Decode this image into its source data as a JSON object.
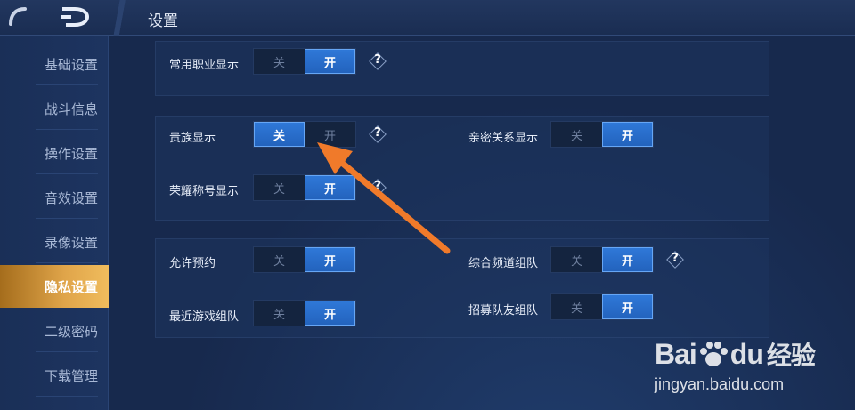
{
  "header": {
    "title": "设置"
  },
  "sidebar": {
    "items": [
      {
        "label": "基础设置"
      },
      {
        "label": "战斗信息"
      },
      {
        "label": "操作设置"
      },
      {
        "label": "音效设置"
      },
      {
        "label": "录像设置"
      },
      {
        "label": "隐私设置",
        "active": true
      },
      {
        "label": "二级密码"
      },
      {
        "label": "下载管理"
      }
    ]
  },
  "toggle_text": {
    "off": "关",
    "on": "开"
  },
  "help_text": "?",
  "settings": {
    "common_job": {
      "label": "常用职业显示",
      "state": "开"
    },
    "noble": {
      "label": "贵族显示",
      "state": "关"
    },
    "intimacy": {
      "label": "亲密关系显示",
      "state": "开"
    },
    "honor_title": {
      "label": "荣耀称号显示",
      "state": "开"
    },
    "allow_booking": {
      "label": "允许预约",
      "state": "开"
    },
    "channel_team": {
      "label": "综合频道组队",
      "state": "开"
    },
    "recent_team": {
      "label": "最近游戏组队",
      "state": "开"
    },
    "recruit_team": {
      "label": "招募队友组队",
      "state": "开"
    }
  },
  "watermark": {
    "brand_a": "Bai",
    "brand_b": "du",
    "brand_cn": "经验",
    "url": "jingyan.baidu.com"
  },
  "colors": {
    "accent_blue": "#2f78d8",
    "active_gold": "#e0a54a",
    "arrow_orange": "#f07a2a"
  }
}
